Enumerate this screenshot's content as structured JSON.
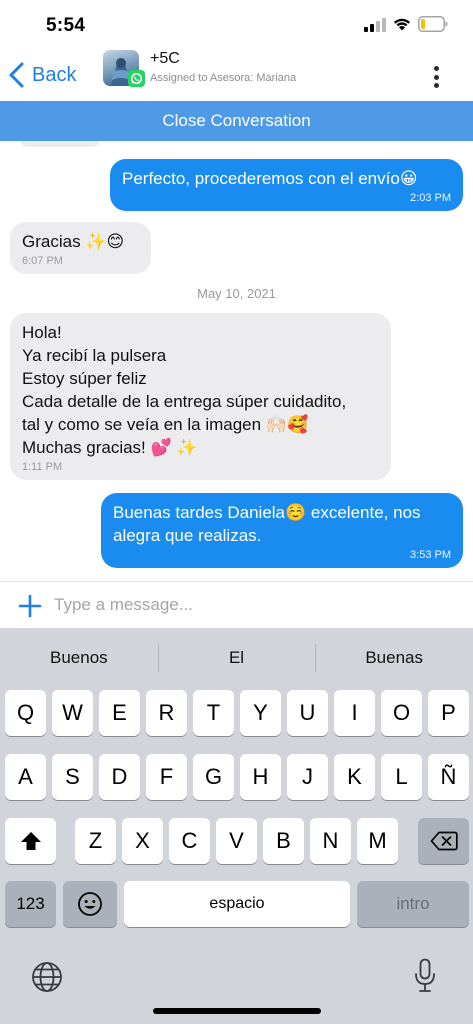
{
  "status_bar": {
    "time": "5:54"
  },
  "header": {
    "back_label": "Back",
    "contact_name": "+5C",
    "contact_subtitle": "Assigned to Asesora: Mariana"
  },
  "close_bar": {
    "label": "Close Conversation"
  },
  "messages": [
    {
      "direction": "out",
      "text": "Perfecto, procederemos con el envío😀",
      "time": "2:03 PM"
    },
    {
      "direction": "in",
      "text": "Gracias ✨😊",
      "time": "6:07 PM"
    },
    {
      "direction": "in",
      "text": "Hola!\nYa recibí la pulsera\nEstoy súper feliz\nCada detalle de la entrega súper cuidadito,\ntal y como se veía en la imagen 🙌🏻🥰\nMuchas gracias! 💕 ✨",
      "time": "1:11 PM"
    },
    {
      "direction": "out",
      "text": "Buenas tardes Daniela☺️ excelente, nos\nalegra que realizas.",
      "time": "3:53 PM"
    }
  ],
  "date_separator": "May 10, 2021",
  "composer": {
    "placeholder": "Type a message..."
  },
  "keyboard": {
    "suggestions": [
      "Buenos",
      "El",
      "Buenas"
    ],
    "row1": [
      "Q",
      "W",
      "E",
      "R",
      "T",
      "Y",
      "U",
      "I",
      "O",
      "P"
    ],
    "row2": [
      "A",
      "S",
      "D",
      "F",
      "G",
      "H",
      "J",
      "K",
      "L",
      "Ñ"
    ],
    "row3": [
      "Z",
      "X",
      "C",
      "V",
      "B",
      "N",
      "M"
    ],
    "numbers_label": "123",
    "space_label": "espacio",
    "return_label": "intro",
    "emoji_glyph": "☺"
  },
  "colors": {
    "accent": "#1a8cf0",
    "close_bar": "#4f9ae6",
    "incoming_bubble": "#ececee",
    "keyboard_bg": "#d1d4da"
  },
  "icons": [
    "signal-icon",
    "wifi-icon",
    "battery-icon",
    "back-chevron-icon",
    "whatsapp-icon",
    "more-icon",
    "plus-icon",
    "shift-icon",
    "backspace-icon",
    "emoji-icon",
    "globe-icon",
    "microphone-icon"
  ]
}
